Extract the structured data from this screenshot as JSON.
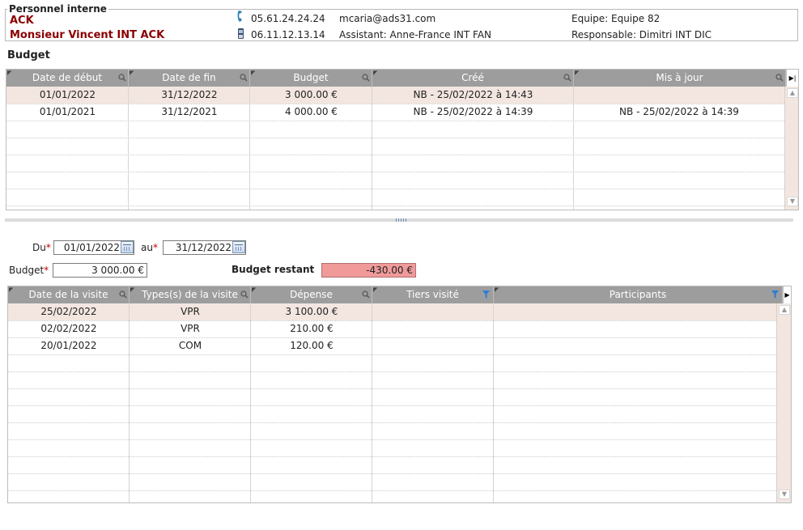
{
  "person": {
    "section_label": "Personnel interne",
    "code": "ACK",
    "full_name": "Monsieur Vincent INT ACK",
    "phone": "05.61.24.24.24",
    "mobile": "06.11.12.13.14",
    "email": "mcaria@ads31.com",
    "assistant": "Assistant: Anne-France INT FAN",
    "team": "Equipe: Equipe 82",
    "manager": "Responsable: Dimitri INT DIC"
  },
  "budget_section": {
    "title": "Budget",
    "columns": [
      "Date de début",
      "Date de fin",
      "Budget",
      "Créé",
      "Mis à jour"
    ],
    "rows": [
      {
        "start": "01/01/2022",
        "end": "31/12/2022",
        "budget": "3 000.00 €",
        "created": "NB - 25/02/2022 à 14:43",
        "updated": ""
      },
      {
        "start": "01/01/2021",
        "end": "31/12/2021",
        "budget": "4 000.00 €",
        "created": "NB - 25/02/2022 à 14:39",
        "updated": "NB - 25/02/2022 à 14:39"
      }
    ]
  },
  "form": {
    "from_label": "Du",
    "from_value": "01/01/2022",
    "to_label": "au",
    "to_value": "31/12/2022",
    "budget_label": "Budget",
    "budget_value": "3 000.00 €",
    "remaining_label": "Budget restant",
    "remaining_value": "-430.00 €",
    "required_mark": "*"
  },
  "visits_section": {
    "columns": [
      "Date de la visite",
      "Types(s) de la visite",
      "Dépense",
      "Tiers visité",
      "Participants"
    ],
    "rows": [
      {
        "date": "25/02/2022",
        "type": "VPR",
        "expense": "3 100.00 €",
        "third_party": "",
        "participants": ""
      },
      {
        "date": "02/02/2022",
        "type": "VPR",
        "expense": "210.00 €",
        "third_party": "",
        "participants": ""
      },
      {
        "date": "20/01/2022",
        "type": "COM",
        "expense": "120.00 €",
        "third_party": "",
        "participants": ""
      }
    ]
  },
  "icons": {
    "phone": "phone-icon",
    "mobile": "mobile-phone-icon",
    "search": "magnifier-icon",
    "filter": "funnel-icon",
    "calendar": "calendar-icon",
    "column_menu": "column-menu-icon"
  },
  "colors": {
    "name_text": "#8b0000",
    "header_bg": "#9d9d9d",
    "selected_row": "#f3e6e0",
    "remaining_bg": "#f09a9a",
    "required": "#c00000",
    "filter_icon": "#2a7fd4"
  }
}
